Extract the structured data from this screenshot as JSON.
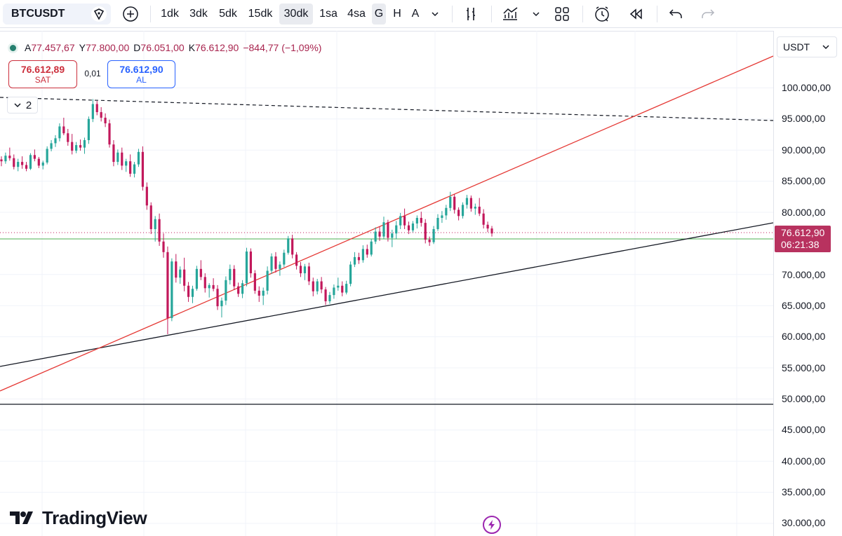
{
  "toolbar": {
    "symbol": "BTCUSDT",
    "timeframes": [
      "1dk",
      "3dk",
      "5dk",
      "15dk",
      "30dk",
      "1sa",
      "4sa",
      "G",
      "H",
      "A"
    ],
    "active_timeframes": [
      "30dk",
      "G"
    ]
  },
  "legend": {
    "open_label": "A",
    "open": "77.457,67",
    "high_label": "Y",
    "high": "77.800,00",
    "low_label": "D",
    "low": "76.051,00",
    "close_label": "K",
    "close": "76.612,90",
    "change": "−844,77 (−1,09%)"
  },
  "trade": {
    "sell_price": "76.612,89",
    "sell_label": "SAT",
    "spread": "0,01",
    "buy_price": "76.612,90",
    "buy_label": "AL"
  },
  "collapse": {
    "count": "2"
  },
  "price_scale": {
    "currency": "USDT",
    "ticks": [
      "100.000,00",
      "95.000,00",
      "90.000,00",
      "85.000,00",
      "80.000,00",
      "70.000,00",
      "65.000,00",
      "60.000,00",
      "55.000,00",
      "50.000,00",
      "45.000,00",
      "40.000,00",
      "35.000,00",
      "30.000,00"
    ],
    "last_price": "76.612,90",
    "countdown": "06:21:38"
  },
  "branding": {
    "logo_text": "TradingView"
  },
  "colors": {
    "up": "#26a69a",
    "down": "#c2185b",
    "last_price": "#b8325f",
    "red_trendline": "#e53935",
    "horizontal_green": "#4caf50"
  },
  "chart_data": {
    "type": "candlestick",
    "symbol": "BTCUSDT",
    "y_ticks": [
      100000,
      95000,
      90000,
      85000,
      80000,
      70000,
      65000,
      60000,
      55000,
      50000,
      45000,
      40000,
      35000,
      30000
    ],
    "last_price": 76612.9,
    "candles": [
      [
        88500,
        89000,
        87400,
        88200
      ],
      [
        88200,
        89600,
        87800,
        89100
      ],
      [
        89100,
        90400,
        88300,
        88700
      ],
      [
        88700,
        89300,
        86900,
        87300
      ],
      [
        87300,
        88600,
        86600,
        88100
      ],
      [
        88100,
        89000,
        87000,
        87600
      ],
      [
        87600,
        88100,
        86600,
        87000
      ],
      [
        87000,
        89500,
        86800,
        89200
      ],
      [
        89200,
        90100,
        88200,
        88600
      ],
      [
        88600,
        88900,
        87100,
        87500
      ],
      [
        87500,
        88300,
        86900,
        88000
      ],
      [
        88000,
        90600,
        87700,
        90200
      ],
      [
        90200,
        91600,
        89800,
        91100
      ],
      [
        91100,
        92400,
        90500,
        91900
      ],
      [
        91900,
        94300,
        91400,
        93800
      ],
      [
        93800,
        95200,
        92400,
        92700
      ],
      [
        92700,
        93400,
        90700,
        91300
      ],
      [
        91300,
        92600,
        89300,
        89900
      ],
      [
        89900,
        91300,
        89500,
        90800
      ],
      [
        90800,
        91700,
        89900,
        90400
      ],
      [
        90400,
        92000,
        89400,
        91600
      ],
      [
        91600,
        95400,
        91000,
        95000
      ],
      [
        95000,
        98200,
        94500,
        97400
      ],
      [
        97400,
        97900,
        95600,
        96100
      ],
      [
        96100,
        96900,
        94600,
        95200
      ],
      [
        95200,
        95900,
        93700,
        94300
      ],
      [
        94300,
        94900,
        90400,
        90900
      ],
      [
        90900,
        91600,
        87400,
        88100
      ],
      [
        88100,
        90100,
        87600,
        89600
      ],
      [
        89600,
        90400,
        86800,
        87500
      ],
      [
        87500,
        88600,
        86500,
        88200
      ],
      [
        88200,
        89300,
        85700,
        86200
      ],
      [
        86200,
        88100,
        85600,
        87700
      ],
      [
        87700,
        90200,
        87300,
        89700
      ],
      [
        89700,
        90600,
        83500,
        84100
      ],
      [
        84100,
        84800,
        80400,
        81100
      ],
      [
        81100,
        81600,
        76500,
        77300
      ],
      [
        77300,
        79400,
        75300,
        78900
      ],
      [
        78900,
        79800,
        74600,
        75300
      ],
      [
        75300,
        76600,
        72700,
        73600
      ],
      [
        73600,
        74500,
        60400,
        63000
      ],
      [
        63000,
        72600,
        62500,
        72100
      ],
      [
        72100,
        73300,
        68700,
        69500
      ],
      [
        69500,
        71300,
        68500,
        70800
      ],
      [
        70800,
        72700,
        67300,
        68200
      ],
      [
        68200,
        68800,
        65600,
        66400
      ],
      [
        66400,
        68200,
        65400,
        67700
      ],
      [
        67700,
        71400,
        67400,
        70900
      ],
      [
        70900,
        72300,
        69100,
        69600
      ],
      [
        69600,
        70200,
        67100,
        67800
      ],
      [
        67800,
        68600,
        66300,
        68300
      ],
      [
        68300,
        69400,
        67300,
        67700
      ],
      [
        67700,
        68300,
        64300,
        64900
      ],
      [
        64900,
        66300,
        63100,
        65800
      ],
      [
        65800,
        69700,
        65100,
        69100
      ],
      [
        69100,
        71600,
        68400,
        70900
      ],
      [
        70900,
        71500,
        67500,
        68100
      ],
      [
        68100,
        68700,
        66400,
        66900
      ],
      [
        66900,
        69100,
        66200,
        68600
      ],
      [
        68600,
        74300,
        68100,
        73700
      ],
      [
        73700,
        74200,
        69500,
        70200
      ],
      [
        70200,
        70700,
        66900,
        67400
      ],
      [
        67400,
        68100,
        65600,
        66600
      ],
      [
        66600,
        67900,
        65100,
        67400
      ],
      [
        67400,
        71300,
        66800,
        70600
      ],
      [
        70600,
        73400,
        70100,
        72900
      ],
      [
        72900,
        73600,
        70300,
        70900
      ],
      [
        70900,
        72100,
        69800,
        71600
      ],
      [
        71600,
        74000,
        71200,
        73500
      ],
      [
        73500,
        76200,
        73200,
        75800
      ],
      [
        75800,
        76400,
        72600,
        73200
      ],
      [
        73200,
        73600,
        70800,
        71400
      ],
      [
        71400,
        72000,
        69600,
        70200
      ],
      [
        70200,
        71700,
        69100,
        71300
      ],
      [
        71300,
        71900,
        68300,
        68900
      ],
      [
        68900,
        69500,
        66500,
        67300
      ],
      [
        67300,
        69300,
        66800,
        68900
      ],
      [
        68900,
        69600,
        67000,
        67600
      ],
      [
        67600,
        68000,
        65100,
        65700
      ],
      [
        65700,
        67200,
        65300,
        66700
      ],
      [
        66700,
        68400,
        66100,
        67900
      ],
      [
        67900,
        69500,
        67400,
        68200
      ],
      [
        68200,
        68900,
        66500,
        67100
      ],
      [
        67100,
        69000,
        66800,
        68500
      ],
      [
        68500,
        72100,
        68100,
        71600
      ],
      [
        71600,
        73600,
        71200,
        72800
      ],
      [
        72800,
        73500,
        71700,
        72300
      ],
      [
        72300,
        74700,
        71900,
        74100
      ],
      [
        74100,
        74800,
        72700,
        73200
      ],
      [
        73200,
        75700,
        72900,
        75300
      ],
      [
        75300,
        77600,
        74900,
        76900
      ],
      [
        76900,
        77700,
        75400,
        76100
      ],
      [
        76100,
        79300,
        75700,
        78400
      ],
      [
        78400,
        78800,
        75300,
        75900
      ],
      [
        75900,
        77200,
        74400,
        76600
      ],
      [
        76600,
        78600,
        75700,
        77900
      ],
      [
        77900,
        79900,
        77300,
        79400
      ],
      [
        79400,
        80600,
        77300,
        77900
      ],
      [
        77900,
        78500,
        76500,
        77100
      ],
      [
        77100,
        78600,
        76800,
        78200
      ],
      [
        78200,
        79500,
        77400,
        79100
      ],
      [
        79100,
        80100,
        77700,
        78300
      ],
      [
        78300,
        78900,
        75000,
        75600
      ],
      [
        75600,
        76100,
        74600,
        75200
      ],
      [
        75200,
        77800,
        74900,
        77300
      ],
      [
        77300,
        79700,
        77000,
        79100
      ],
      [
        79100,
        80200,
        78300,
        79500
      ],
      [
        79500,
        81200,
        78800,
        80700
      ],
      [
        80700,
        83300,
        80200,
        82500
      ],
      [
        82500,
        82900,
        79800,
        80400
      ],
      [
        80400,
        80800,
        78700,
        79400
      ],
      [
        79400,
        81600,
        79000,
        81200
      ],
      [
        81200,
        82800,
        80600,
        82300
      ],
      [
        82300,
        82700,
        80100,
        80600
      ],
      [
        80600,
        81400,
        79600,
        80900
      ],
      [
        80900,
        82300,
        79400,
        79800
      ],
      [
        79800,
        80500,
        77400,
        78000
      ],
      [
        78000,
        78500,
        76800,
        77400
      ],
      [
        77400,
        77800,
        76100,
        76600
      ]
    ]
  }
}
